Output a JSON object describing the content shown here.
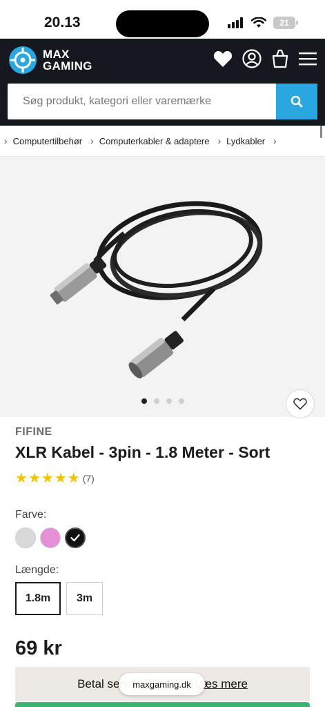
{
  "status_bar": {
    "time": "20.13",
    "battery": "21"
  },
  "header": {
    "logo_line1": "MAX",
    "logo_line2": "GAMING",
    "icons": [
      "heart-icon",
      "user-icon",
      "bag-icon",
      "menu-icon"
    ],
    "colors": {
      "background": "#16181f",
      "accent": "#2aa6e0"
    }
  },
  "search": {
    "placeholder": "Søg produkt, kategori eller varemærke"
  },
  "breadcrumb": {
    "items": [
      "Computertilbehør",
      "Computerkabler & adaptere",
      "Lydkabler"
    ]
  },
  "gallery": {
    "image_count": 4,
    "active_index": 0
  },
  "product": {
    "brand": "FIFINE",
    "title": "XLR Kabel - 3pin - 1.8 Meter - Sort",
    "rating_stars": 5,
    "rating_count": "(7)",
    "color_label": "Farve:",
    "colors": [
      {
        "name": "grey",
        "hex": "#d9d9d9",
        "selected": false
      },
      {
        "name": "pink",
        "hex": "#e58fd6",
        "selected": false
      },
      {
        "name": "black",
        "hex": "#111111",
        "selected": true
      }
    ],
    "length_label": "Længde:",
    "lengths": [
      {
        "label": "1.8m",
        "selected": true
      },
      {
        "label": "3m",
        "selected": false
      }
    ],
    "price": "69 kr"
  },
  "payment": {
    "text": "Betal sene",
    "link": "Læs mere"
  },
  "browser": {
    "url": "maxgaming.dk"
  }
}
